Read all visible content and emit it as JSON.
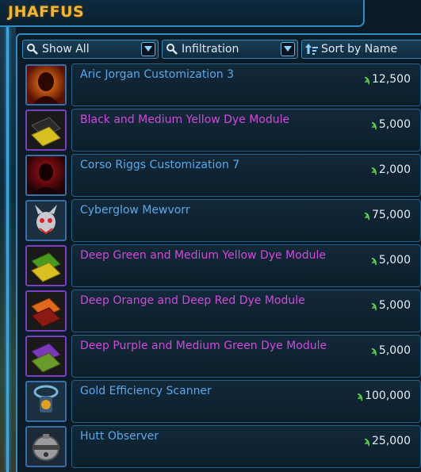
{
  "window": {
    "title": "JHAFFUS"
  },
  "filters": {
    "category": {
      "value": "Show All"
    },
    "subcategory": {
      "value": "Infiltration"
    },
    "sort": {
      "value": "Sort by Name"
    }
  },
  "colors": {
    "title": "#f2b632",
    "frame": "#2f8cc4",
    "name_blue": "#5aa8ea",
    "name_purple": "#d24ad8",
    "credits": "#5ddc4a"
  },
  "currency_icon": "credits-icon",
  "items": [
    {
      "name": "Aric Jorgan Customization 3",
      "price": "12,500",
      "rarity": "blue",
      "icon": "cathar-portrait-icon"
    },
    {
      "name": "Black and Medium Yellow Dye Module",
      "price": "5,000",
      "rarity": "purple",
      "icon": "dye-module-icon"
    },
    {
      "name": "Corso Riggs Customization 7",
      "price": "2,000",
      "rarity": "blue",
      "icon": "red-portrait-icon"
    },
    {
      "name": "Cyberglow Mewvorr",
      "price": "75,000",
      "rarity": "blue",
      "icon": "pet-icon"
    },
    {
      "name": "Deep Green and Medium Yellow Dye Module",
      "price": "5,000",
      "rarity": "purple",
      "icon": "dye-module-icon"
    },
    {
      "name": "Deep Orange and Deep Red Dye Module",
      "price": "5,000",
      "rarity": "purple",
      "icon": "dye-module-icon"
    },
    {
      "name": "Deep Purple and Medium Green Dye Module",
      "price": "5,000",
      "rarity": "purple",
      "icon": "dye-module-icon"
    },
    {
      "name": "Gold Efficiency Scanner",
      "price": "100,000",
      "rarity": "blue",
      "icon": "scanner-icon"
    },
    {
      "name": "Hutt Observer",
      "price": "25,000",
      "rarity": "blue",
      "icon": "droid-icon"
    }
  ]
}
